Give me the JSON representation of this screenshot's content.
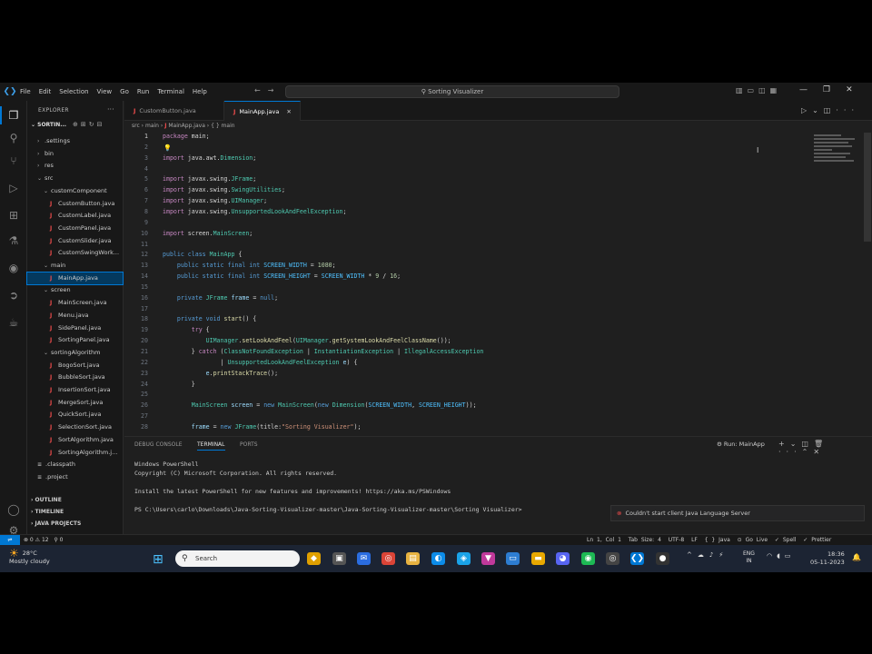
{
  "window": {
    "search_title": "Sorting Visualizer",
    "menu": [
      "File",
      "Edit",
      "Selection",
      "View",
      "Go",
      "Run",
      "Terminal",
      "Help"
    ]
  },
  "sidebar": {
    "title": "EXPLORER",
    "project": "SORTIN...",
    "tree": [
      {
        "label": ".settings",
        "indent": 1,
        "kind": "folder-closed"
      },
      {
        "label": "bin",
        "indent": 1,
        "kind": "folder-closed"
      },
      {
        "label": "res",
        "indent": 1,
        "kind": "folder-closed"
      },
      {
        "label": "src",
        "indent": 1,
        "kind": "folder-open"
      },
      {
        "label": "customComponent",
        "indent": 2,
        "kind": "folder-open"
      },
      {
        "label": "CustomButton.java",
        "indent": 3,
        "kind": "java"
      },
      {
        "label": "CustomLabel.java",
        "indent": 3,
        "kind": "java"
      },
      {
        "label": "CustomPanel.java",
        "indent": 3,
        "kind": "java"
      },
      {
        "label": "CustomSlider.java",
        "indent": 3,
        "kind": "java"
      },
      {
        "label": "CustomSwingWork...",
        "indent": 3,
        "kind": "java"
      },
      {
        "label": "main",
        "indent": 2,
        "kind": "folder-open"
      },
      {
        "label": "MainApp.java",
        "indent": 3,
        "kind": "java",
        "selected": true
      },
      {
        "label": "screen",
        "indent": 2,
        "kind": "folder-open"
      },
      {
        "label": "MainScreen.java",
        "indent": 3,
        "kind": "java"
      },
      {
        "label": "Menu.java",
        "indent": 3,
        "kind": "java"
      },
      {
        "label": "SidePanel.java",
        "indent": 3,
        "kind": "java"
      },
      {
        "label": "SortingPanel.java",
        "indent": 3,
        "kind": "java"
      },
      {
        "label": "sortingAlgorithm",
        "indent": 2,
        "kind": "folder-open"
      },
      {
        "label": "BogoSort.java",
        "indent": 3,
        "kind": "java"
      },
      {
        "label": "BubbleSort.java",
        "indent": 3,
        "kind": "java"
      },
      {
        "label": "InsertionSort.java",
        "indent": 3,
        "kind": "java"
      },
      {
        "label": "MergeSort.java",
        "indent": 3,
        "kind": "java"
      },
      {
        "label": "QuickSort.java",
        "indent": 3,
        "kind": "java"
      },
      {
        "label": "SelectionSort.java",
        "indent": 3,
        "kind": "java"
      },
      {
        "label": "SortAlgorithm.java",
        "indent": 3,
        "kind": "java"
      },
      {
        "label": "SortingAlgorithm.j...",
        "indent": 3,
        "kind": "java"
      },
      {
        "label": ".classpath",
        "indent": 1,
        "kind": "file"
      },
      {
        "label": ".project",
        "indent": 1,
        "kind": "file"
      }
    ],
    "sections": [
      "OUTLINE",
      "TIMELINE",
      "JAVA PROJECTS"
    ]
  },
  "tabs": [
    {
      "label": "CustomButton.java",
      "active": false
    },
    {
      "label": "MainApp.java",
      "active": true
    }
  ],
  "breadcrumb": [
    "src",
    "main",
    "MainApp.java",
    "{ } main"
  ],
  "code": {
    "current_line": 1,
    "lines": [
      {
        "n": "1",
        "html": "<span class='k2'>package</span> main;"
      },
      {
        "n": "2",
        "html": ""
      },
      {
        "n": "3",
        "html": "<span class='k2'>import</span> java.awt.<span class='ty'>Dimension</span>;"
      },
      {
        "n": "4",
        "html": ""
      },
      {
        "n": "5",
        "html": "<span class='k2'>import</span> javax.swing.<span class='ty'>JFrame</span>;"
      },
      {
        "n": "6",
        "html": "<span class='k2'>import</span> javax.swing.<span class='ty'>SwingUtilities</span>;"
      },
      {
        "n": "7",
        "html": "<span class='k2'>import</span> javax.swing.<span class='ty'>UIManager</span>;"
      },
      {
        "n": "8",
        "html": "<span class='k2'>import</span> javax.swing.<span class='ty'>UnsupportedLookAndFeelException</span>;"
      },
      {
        "n": "9",
        "html": ""
      },
      {
        "n": "10",
        "html": "<span class='k2'>import</span> screen.<span class='ty'>MainScreen</span>;"
      },
      {
        "n": "11",
        "html": ""
      },
      {
        "n": "12",
        "html": "<span class='k1'>public class</span> <span class='ty'>MainApp</span> {"
      },
      {
        "n": "13",
        "html": "    <span class='k1'>public static final int</span> <span class='cn'>SCREEN_WIDTH</span> = <span class='nu'>1080</span>;"
      },
      {
        "n": "14",
        "html": "    <span class='k1'>public static final int</span> <span class='cn'>SCREEN_HEIGHT</span> = <span class='cn'>SCREEN_WIDTH</span> * <span class='nu'>9</span> / <span class='nu'>16</span>;"
      },
      {
        "n": "15",
        "html": ""
      },
      {
        "n": "16",
        "html": "    <span class='k1'>private</span> <span class='ty'>JFrame</span> <span class='va'>frame</span> = <span class='k1'>null</span>;"
      },
      {
        "n": "17",
        "html": ""
      },
      {
        "n": "18",
        "html": "    <span class='k1'>private void</span> <span class='fn'>start</span>() {"
      },
      {
        "n": "19",
        "html": "        <span class='k2'>try</span> {"
      },
      {
        "n": "20",
        "html": "            <span class='ty'>UIManager</span>.<span class='fn'>setLookAndFeel</span>(<span class='ty'>UIManager</span>.<span class='fn'>getSystemLookAndFeelClassName</span>());"
      },
      {
        "n": "21",
        "html": "        } <span class='k2'>catch</span> (<span class='ty'>ClassNotFoundException</span> | <span class='ty'>InstantiationException</span> | <span class='ty'>IllegalAccessException</span>"
      },
      {
        "n": "22",
        "html": "                | <span class='ty'>UnsupportedLookAndFeelException</span> <span class='va'>e</span>) {"
      },
      {
        "n": "23",
        "html": "            <span class='va'>e</span>.<span class='fn'>printStackTrace</span>();"
      },
      {
        "n": "24",
        "html": "        }"
      },
      {
        "n": "25",
        "html": ""
      },
      {
        "n": "26",
        "html": "        <span class='ty'>MainScreen</span> <span class='va'>screen</span> = <span class='k1'>new</span> <span class='ty'>MainScreen</span>(<span class='k1'>new</span> <span class='ty'>Dimension</span>(<span class='cn'>SCREEN_WIDTH</span>, <span class='cn'>SCREEN_HEIGHT</span>));"
      },
      {
        "n": "27",
        "html": ""
      },
      {
        "n": "28",
        "html": "        <span class='va'>frame</span> = <span class='k1'>new</span> <span class='ty'>JFrame</span>(title:<span class='st'>\"Sorting Visualizer\"</span>);"
      }
    ]
  },
  "panel": {
    "tabs": [
      "DEBUG CONSOLE",
      "TERMINAL",
      "PORTS"
    ],
    "active_tab": "TERMINAL",
    "run_label": "Run: MainApp",
    "terminal": [
      "Windows PowerShell",
      "Copyright (C) Microsoft Corporation. All rights reserved.",
      "",
      "Install the latest PowerShell for new features and improvements! https://aka.ms/PSWindows",
      "",
      "PS C:\\Users\\carlo\\Downloads\\Java-Sorting-Visualizer-master\\Java-Sorting-Visualizer-master\\Sorting Visualizer>"
    ]
  },
  "notification": "Couldn't start client Java Language Server",
  "statusbar": {
    "problems": "⊗ 0 ⚠ 12",
    "ports": "⚲ 0",
    "position": "Ln 1, Col 1",
    "tab_size": "Tab Size: 4",
    "encoding": "UTF-8",
    "eol": "LF",
    "language": "{ } Java",
    "golive": "⊙ Go Live",
    "spell": "✓ Spell",
    "prettier": "✓ Prettier"
  },
  "taskbar": {
    "weather_temp": "28°C",
    "weather_desc": "Mostly cloudy",
    "search_placeholder": "Search",
    "lang_1": "ENG",
    "lang_2": "IN",
    "time": "18:36",
    "date": "05-11-2023"
  },
  "colors": {
    "accent": "#0078d4",
    "java_icon": "#f14c4c",
    "selection": "#04395e"
  }
}
